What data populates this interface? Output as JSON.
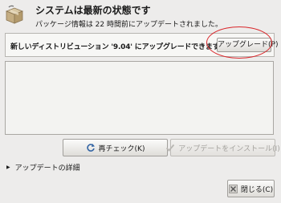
{
  "status": {
    "title": "システムは最新の状態です",
    "subtitle": "パッケージ情報は 22 時間前にアップデートされました。"
  },
  "upgrade": {
    "message": "新しいディストリビューション '9.04' にアップグレードできます",
    "button_label": "アップグレード(P)"
  },
  "actions": {
    "check_label": "再チェック(K)",
    "install_label": "アップデートをインストール(I)",
    "details_label": "アップデートの詳細",
    "close_label": "閉じる(C)"
  },
  "icons": {
    "app": "package-box-icon",
    "check": "refresh-icon",
    "install": "check-mark-icon",
    "details": "expander-triangle-icon",
    "close": "close-x-icon"
  },
  "colors": {
    "window_background": "#edeceb",
    "highlight_ring": "#d9262a",
    "refresh_icon": "#3465a4",
    "disabled_text": "#a3a19d"
  }
}
